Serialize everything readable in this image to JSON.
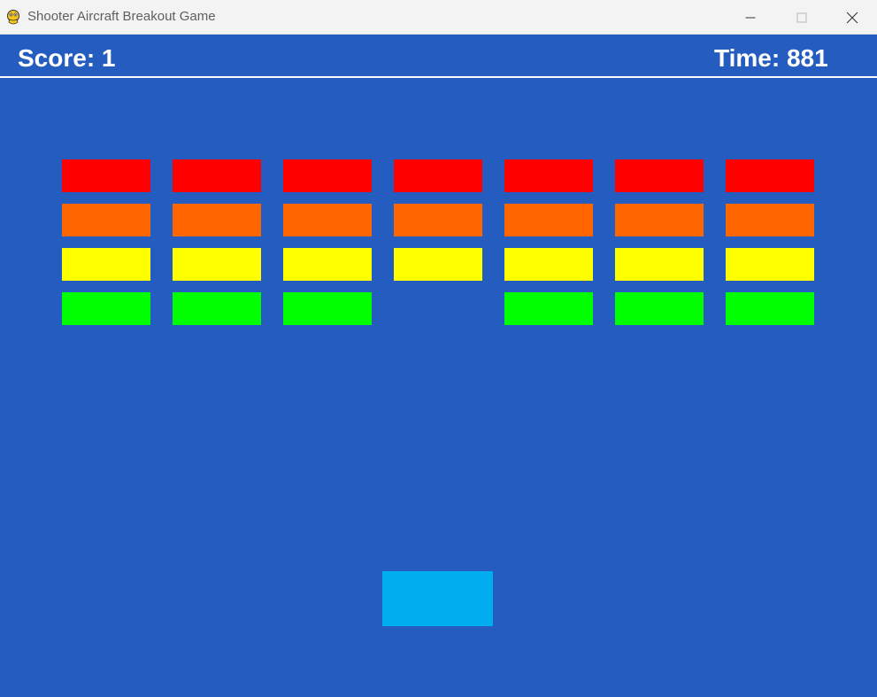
{
  "window": {
    "title": "Shooter Aircraft Breakout Game",
    "app_icon": "pygame-snake-icon",
    "controls": {
      "minimize_icon": "minimize-icon",
      "maximize_icon": "maximize-icon",
      "close_icon": "close-icon"
    }
  },
  "hud": {
    "score_text": "Score: 1",
    "time_text": "Time: 881",
    "text_color": "#ffffff"
  },
  "colors": {
    "background": "#245dbf",
    "paddle": "#00aeef",
    "rows": [
      "#ff0000",
      "#ff6600",
      "#ffff00",
      "#00ff00"
    ]
  },
  "bricks": [
    [
      true,
      true,
      true,
      true,
      true,
      true,
      true
    ],
    [
      true,
      true,
      true,
      true,
      true,
      true,
      true
    ],
    [
      true,
      true,
      true,
      true,
      true,
      true,
      true
    ],
    [
      true,
      true,
      true,
      false,
      true,
      true,
      true
    ]
  ]
}
